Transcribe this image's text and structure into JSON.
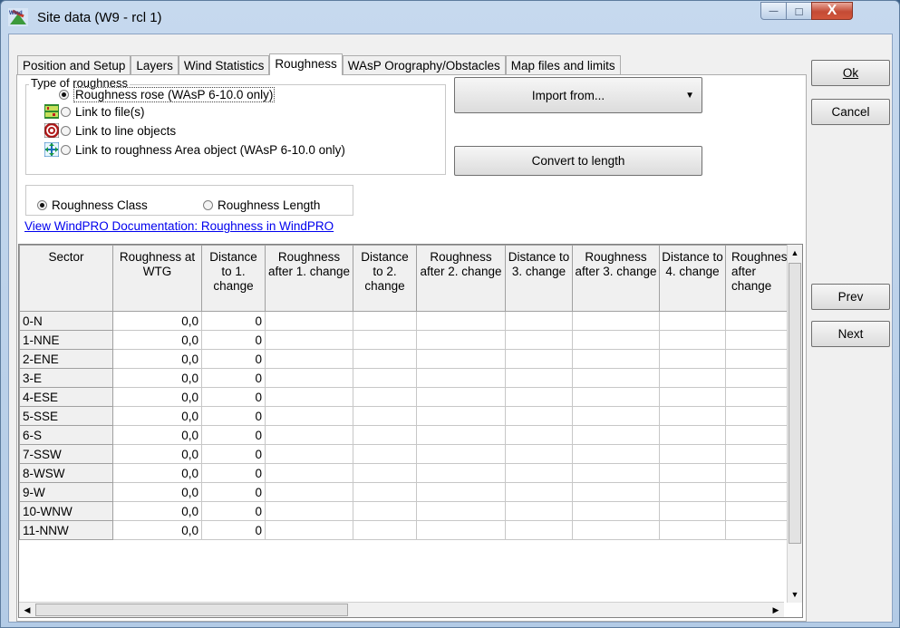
{
  "window": {
    "title": "Site data  (W9 - rcl 1)"
  },
  "titlebar": {
    "minimize": "—",
    "maximize": "□",
    "close": "X"
  },
  "tabs": [
    {
      "label": "Position and Setup"
    },
    {
      "label": "Layers"
    },
    {
      "label": "Wind Statistics"
    },
    {
      "label": "Roughness"
    },
    {
      "label": "WAsP Orography/Obstacles"
    },
    {
      "label": "Map files and limits"
    }
  ],
  "roughness_type": {
    "legend": "Type of roughness",
    "options": [
      {
        "label": "Roughness rose (WAsP 6-10.0 only)"
      },
      {
        "label": "Link to file(s)"
      },
      {
        "label": "Link to line objects"
      },
      {
        "label": "Link to roughness Area object (WAsP 6-10.0 only)"
      }
    ]
  },
  "buttons": {
    "import_from": "Import from...",
    "convert": "Convert to length",
    "ok": "Ok",
    "cancel": "Cancel",
    "prev": "Prev",
    "next": "Next"
  },
  "mode": {
    "class_label": "Roughness Class",
    "length_label": "Roughness Length"
  },
  "doc_link": "View WindPRO Documentation: Roughness in WindPRO",
  "table": {
    "headers": [
      "Sector",
      "Roughness at WTG",
      "Distance to 1. change",
      "Roughness after 1. change",
      "Distance to 2. change",
      "Roughness after 2. change",
      "Distance to 3. change",
      "Roughness after 3. change",
      "Distance to 4. change",
      "Roughness after change"
    ],
    "rows": [
      {
        "sector": "0-N",
        "rough": "0,0",
        "dist": "0"
      },
      {
        "sector": "1-NNE",
        "rough": "0,0",
        "dist": "0"
      },
      {
        "sector": "2-ENE",
        "rough": "0,0",
        "dist": "0"
      },
      {
        "sector": "3-E",
        "rough": "0,0",
        "dist": "0"
      },
      {
        "sector": "4-ESE",
        "rough": "0,0",
        "dist": "0"
      },
      {
        "sector": "5-SSE",
        "rough": "0,0",
        "dist": "0"
      },
      {
        "sector": "6-S",
        "rough": "0,0",
        "dist": "0"
      },
      {
        "sector": "7-SSW",
        "rough": "0,0",
        "dist": "0"
      },
      {
        "sector": "8-WSW",
        "rough": "0,0",
        "dist": "0"
      },
      {
        "sector": "9-W",
        "rough": "0,0",
        "dist": "0"
      },
      {
        "sector": "10-WNW",
        "rough": "0,0",
        "dist": "0"
      },
      {
        "sector": "11-NNW",
        "rough": "0,0",
        "dist": "0"
      }
    ]
  }
}
